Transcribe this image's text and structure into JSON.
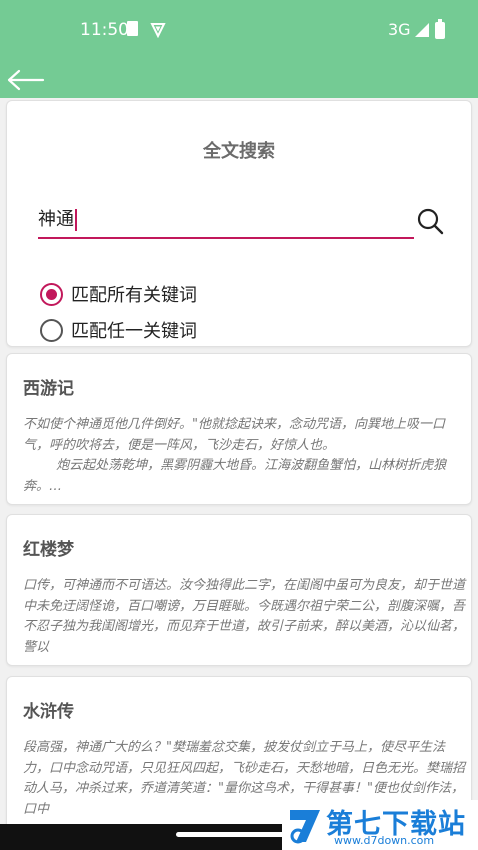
{
  "status": {
    "time": "11:50",
    "network": "3G"
  },
  "search": {
    "title": "全文搜索",
    "query": "神通",
    "options": [
      "匹配所有关键词",
      "匹配任一关键词"
    ],
    "selected_option": 0
  },
  "results": [
    {
      "title": "西游记",
      "snippet": "不如使个神通觅他几件倒好。\"他就捻起诀来，念动咒语，向巽地上吸一口气，呼的吹将去，便是一阵风，飞沙走石，好惊人也。\n        炮云起处荡乾坤，黑雾阴霾大地昏。江海波翻鱼蟹怕，山林树折虎狼奔。…"
    },
    {
      "title": "红楼梦",
      "snippet": "口传，可神通而不可语达。汝今独得此二字，在闺阁中虽可为良友，却于世道中未免迂阔怪诡，百口嘲谤，万目睚眦。今既遇尔祖宁荣二公，剖腹深嘱，吾不忍子独为我闺阁增光，而见弃于世道，故引子前来，醉以美酒，沁以仙茗，警以"
    },
    {
      "title": "水浒传",
      "snippet": "段高强，神通广大的么？\"樊瑞羞忿交集，披发仗剑立于马上，使尽平生法力，口中念动咒语，只见狂风四起，飞砂走石，天愁地暗，日色无光。樊瑞招动人马，冲杀过来，乔道清笑道：\"量你这鸟术，干得甚事！\"便也仗剑作法，口中"
    }
  ],
  "watermark": {
    "name": "第七下载站",
    "url": "www.d7down.com"
  }
}
